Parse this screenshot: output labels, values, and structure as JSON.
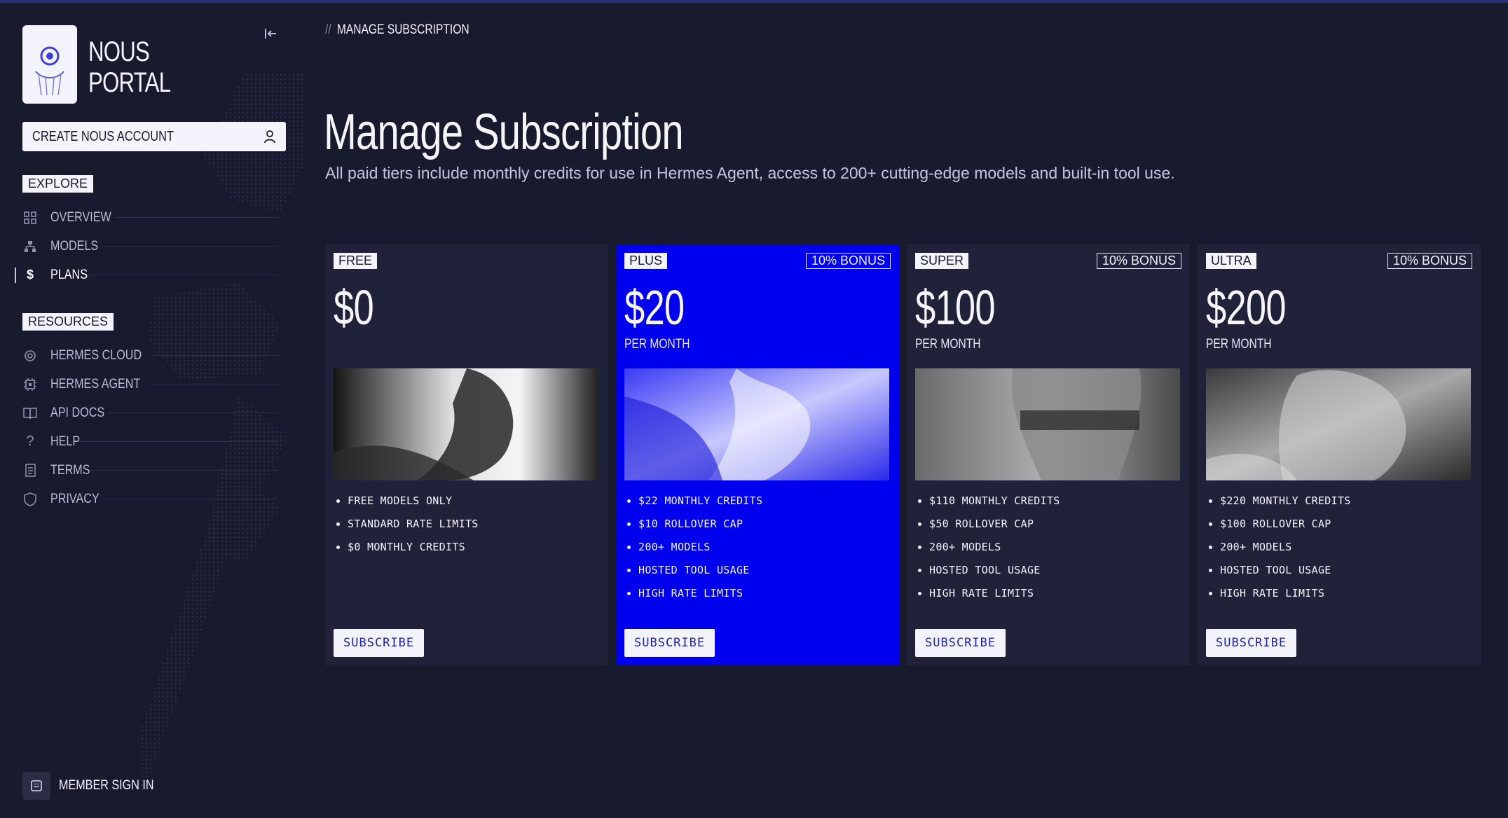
{
  "app": {
    "brand_line1": "NOUS",
    "brand_line2": "PORTAL"
  },
  "sidebar": {
    "create_account_label": "CREATE NOUS ACCOUNT",
    "explore_heading": "EXPLORE",
    "explore_items": [
      {
        "label": "OVERVIEW",
        "icon": "grid-icon"
      },
      {
        "label": "MODELS",
        "icon": "hierarchy-icon"
      },
      {
        "label": "PLANS",
        "icon": "dollar-icon",
        "active": true
      }
    ],
    "resources_heading": "RESOURCES",
    "resources_items": [
      {
        "label": "HERMES CLOUD",
        "icon": "gear-icon"
      },
      {
        "label": "HERMES AGENT",
        "icon": "chip-icon"
      },
      {
        "label": "API DOCS",
        "icon": "book-icon"
      },
      {
        "label": "HELP",
        "icon": "question-icon"
      },
      {
        "label": "TERMS",
        "icon": "document-icon"
      },
      {
        "label": "PRIVACY",
        "icon": "shield-icon"
      }
    ],
    "member_sign_in_label": "MEMBER SIGN IN"
  },
  "header": {
    "breadcrumb_separator": "//",
    "breadcrumb": "MANAGE SUBSCRIPTION"
  },
  "main": {
    "title": "Manage Subscription",
    "subtitle": "All paid tiers include monthly credits for use in Hermes Agent, access to 200+ cutting-edge models and built-in tool use."
  },
  "plans": [
    {
      "tier": "FREE",
      "price": "$0",
      "period": "",
      "bonus": "",
      "features": [
        "FREE MODELS ONLY",
        "STANDARD RATE LIMITS",
        "$0 MONTHLY CREDITS"
      ],
      "cta": "SUBSCRIBE"
    },
    {
      "tier": "PLUS",
      "price": "$20",
      "period": "PER MONTH",
      "bonus": "10% BONUS",
      "features": [
        "$22 MONTHLY CREDITS",
        "$10 ROLLOVER CAP",
        "200+ MODELS",
        "HOSTED TOOL USAGE",
        "HIGH RATE LIMITS"
      ],
      "cta": "SUBSCRIBE"
    },
    {
      "tier": "SUPER",
      "price": "$100",
      "period": "PER MONTH",
      "bonus": "10% BONUS",
      "features": [
        "$110 MONTHLY CREDITS",
        "$50 ROLLOVER CAP",
        "200+ MODELS",
        "HOSTED TOOL USAGE",
        "HIGH RATE LIMITS"
      ],
      "cta": "SUBSCRIBE"
    },
    {
      "tier": "ULTRA",
      "price": "$200",
      "period": "PER MONTH",
      "bonus": "10% BONUS",
      "features": [
        "$220 MONTHLY CREDITS",
        "$100 ROLLOVER CAP",
        "200+ MODELS",
        "HOSTED TOOL USAGE",
        "HIGH RATE LIMITS"
      ],
      "cta": "SUBSCRIBE"
    }
  ],
  "colors": {
    "background": "#181a2e",
    "card": "#20223a",
    "featured_card": "#0000ee",
    "text": "#f3f4fb",
    "button_text": "#1f22b8"
  }
}
